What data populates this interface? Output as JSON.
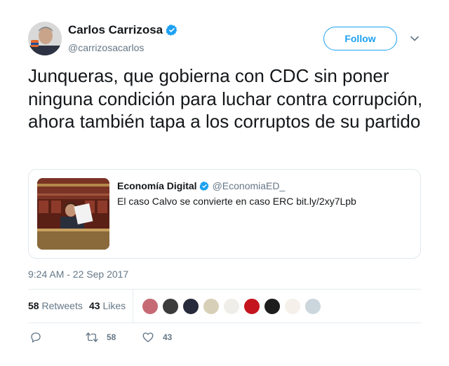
{
  "author": {
    "name": "Carlos Carrizosa",
    "handle": "@carrizosacarlos"
  },
  "follow_label": "Follow",
  "tweet_text": "Junqueras, que gobierna con CDC sin poner ninguna condición para luchar contra corrupción, ahora también tapa a los corruptos de su partido",
  "quote": {
    "name": "Economía Digital",
    "handle": "@EconomiaED_",
    "text": "El caso Calvo se convierte en caso ERC bit.ly/2xy7Lpb"
  },
  "timestamp": "9:24 AM - 22 Sep 2017",
  "stats": {
    "retweets_count": "58",
    "retweets_label": "Retweets",
    "likes_count": "43",
    "likes_label": "Likes"
  },
  "likers": [
    {
      "color": "#c56a74"
    },
    {
      "color": "#3b3b3b"
    },
    {
      "color": "#262a3a"
    },
    {
      "color": "#d8cfb8"
    },
    {
      "color": "#efeee8"
    },
    {
      "color": "#c4141e"
    },
    {
      "color": "#1d1d1d"
    },
    {
      "color": "#f5f0ea"
    },
    {
      "color": "#ccd6dd"
    }
  ],
  "actions": {
    "retweet_count": "58",
    "like_count": "43"
  },
  "colors": {
    "accent": "#1da1f2",
    "muted": "#657786",
    "text": "#14171a",
    "border": "#e1e8ed"
  }
}
